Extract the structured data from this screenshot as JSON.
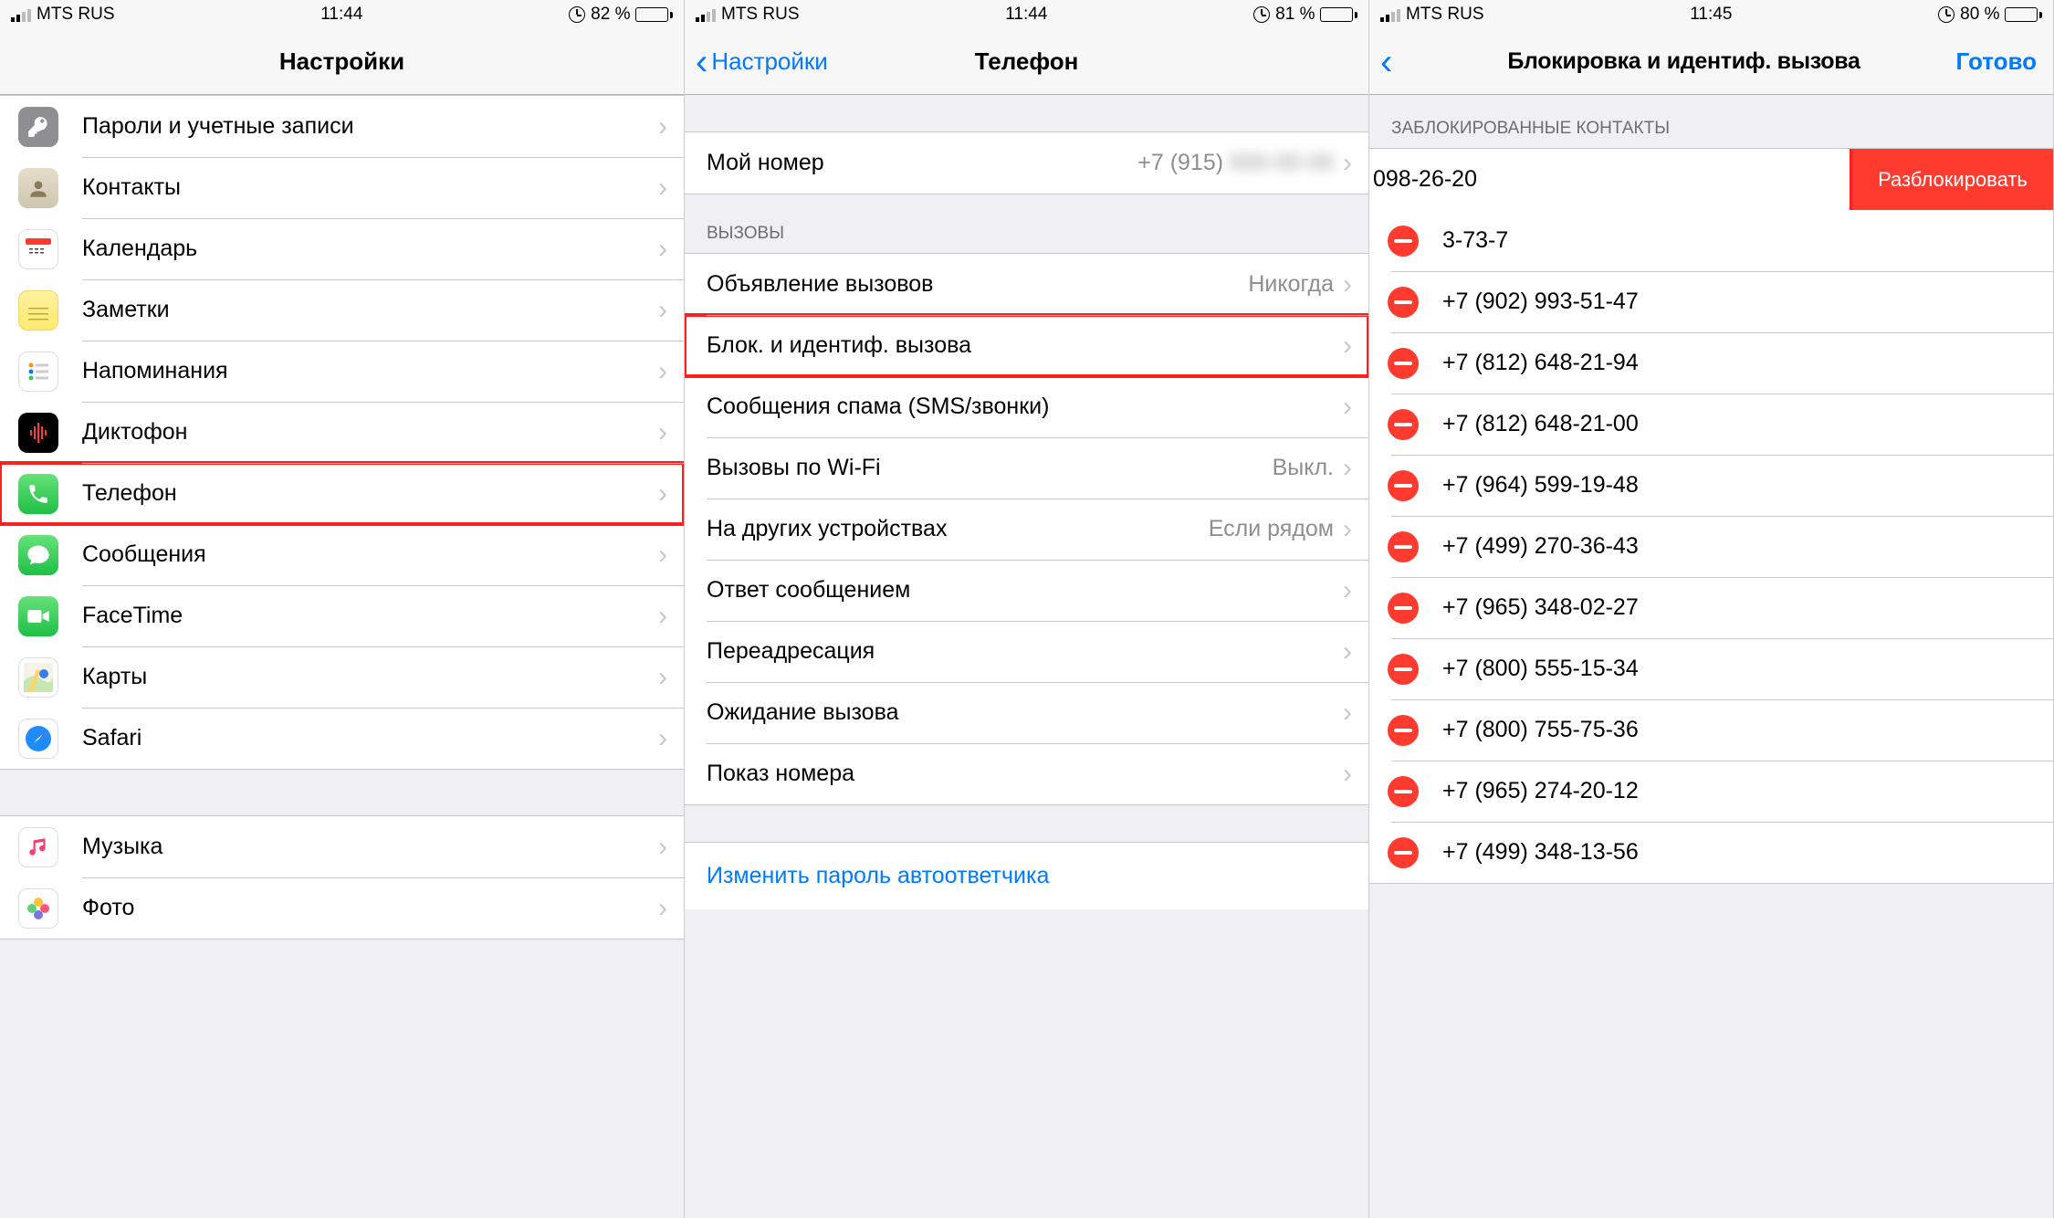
{
  "panes": [
    {
      "status": {
        "carrier": "MTS RUS",
        "time": "11:44",
        "battery_pct": "82 %",
        "battery_fill": 82
      },
      "nav": {
        "title": "Настройки"
      },
      "groups": [
        {
          "header": null,
          "rows": [
            {
              "id": "passwords",
              "label": "Пароли и учетные записи",
              "icon": "key",
              "bg": "#8e8e93"
            },
            {
              "id": "contacts",
              "label": "Контакты",
              "icon": "contacts",
              "bg": "#d9d3c9"
            },
            {
              "id": "calendar",
              "label": "Календарь",
              "icon": "calendar",
              "bg": "#ffffff"
            },
            {
              "id": "notes",
              "label": "Заметки",
              "icon": "notes",
              "bg": "#fff19a"
            },
            {
              "id": "reminders",
              "label": "Напоминания",
              "icon": "reminders",
              "bg": "#ffffff"
            },
            {
              "id": "voice",
              "label": "Диктофон",
              "icon": "voice",
              "bg": "#000000"
            },
            {
              "id": "phone",
              "label": "Телефон",
              "icon": "phone",
              "bg": "#33c759",
              "highlight": true
            },
            {
              "id": "messages",
              "label": "Сообщения",
              "icon": "messages",
              "bg": "#33c759"
            },
            {
              "id": "facetime",
              "label": "FaceTime",
              "icon": "facetime",
              "bg": "#33c759"
            },
            {
              "id": "maps",
              "label": "Карты",
              "icon": "maps",
              "bg": "#ffffff"
            },
            {
              "id": "safari",
              "label": "Safari",
              "icon": "safari",
              "bg": "#ffffff"
            }
          ]
        },
        {
          "header": null,
          "rows": [
            {
              "id": "music",
              "label": "Музыка",
              "icon": "music",
              "bg": "#ffffff"
            },
            {
              "id": "photos",
              "label": "Фото",
              "icon": "photos",
              "bg": "#ffffff"
            }
          ]
        }
      ]
    },
    {
      "status": {
        "carrier": "MTS RUS",
        "time": "11:44",
        "battery_pct": "81 %",
        "battery_fill": 81
      },
      "nav": {
        "back": "Настройки",
        "title": "Телефон"
      },
      "my_number": {
        "label": "Мой номер",
        "value": "+7 (915)",
        "masked": true
      },
      "calls_header": "ВЫЗОВЫ",
      "rows": [
        {
          "id": "announce",
          "label": "Объявление вызовов",
          "value": "Никогда"
        },
        {
          "id": "block-id",
          "label": "Блок. и идентиф. вызова",
          "highlight": true
        },
        {
          "id": "spam",
          "label": "Сообщения спама (SMS/звонки)"
        },
        {
          "id": "wifi-calls",
          "label": "Вызовы по Wi-Fi",
          "value": "Выкл."
        },
        {
          "id": "other-devices",
          "label": "На других устройствах",
          "value": "Если рядом"
        },
        {
          "id": "reply-msg",
          "label": "Ответ сообщением"
        },
        {
          "id": "forwarding",
          "label": "Переадресация"
        },
        {
          "id": "waiting",
          "label": "Ожидание вызова"
        },
        {
          "id": "caller-id",
          "label": "Показ номера"
        }
      ],
      "link": "Изменить пароль автоответчика"
    },
    {
      "status": {
        "carrier": "MTS RUS",
        "time": "11:45",
        "battery_pct": "80 %",
        "battery_fill": 80
      },
      "nav": {
        "title": "Блокировка и идентиф. вызова",
        "done": "Готово"
      },
      "section_header": "ЗАБЛОКИРОВАННЫЕ КОНТАКТЫ",
      "unblock_label": "Разблокировать",
      "shifted_number": "098-26-20",
      "blocked": [
        "3-73-7",
        "+7 (902) 993-51-47",
        "+7 (812) 648-21-94",
        "+7 (812) 648-21-00",
        "+7 (964) 599-19-48",
        "+7 (499) 270-36-43",
        "+7 (965) 348-02-27",
        "+7 (800) 555-15-34",
        "+7 (800) 755-75-36",
        "+7 (965) 274-20-12",
        "+7 (499) 348-13-56"
      ]
    }
  ]
}
